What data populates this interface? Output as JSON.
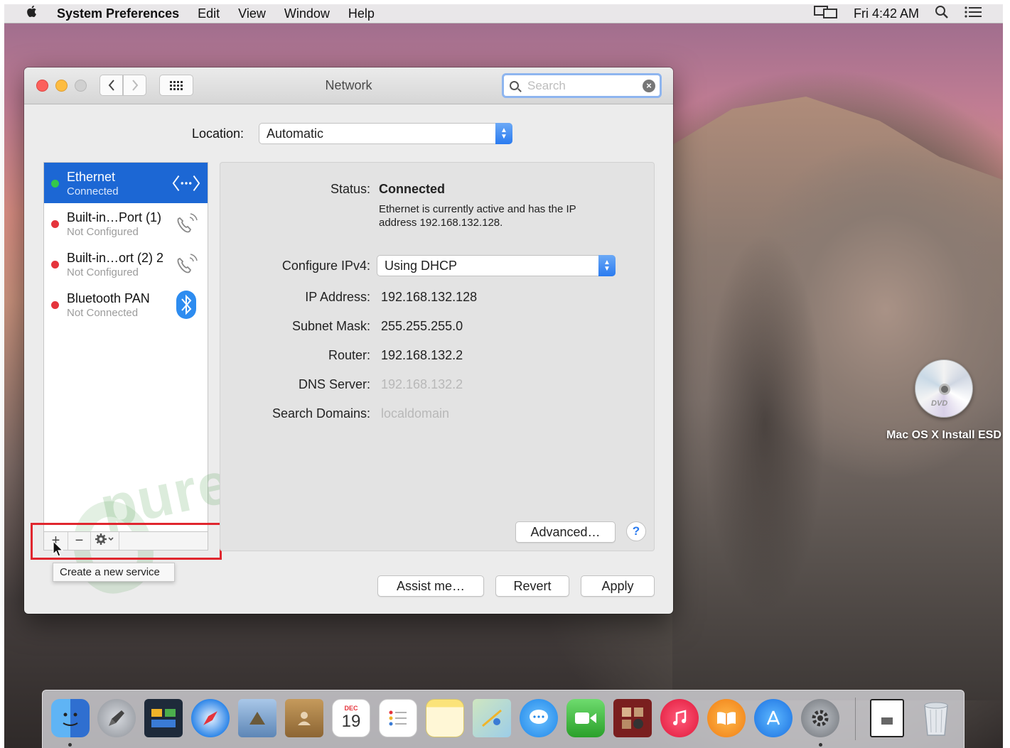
{
  "menubar": {
    "app_name": "System Preferences",
    "items": [
      "Edit",
      "View",
      "Window",
      "Help"
    ],
    "clock": "Fri 4:42 AM"
  },
  "window": {
    "title": "Network",
    "search_placeholder": "Search"
  },
  "location": {
    "label": "Location:",
    "value": "Automatic"
  },
  "services": [
    {
      "name": "Ethernet",
      "status": "Connected",
      "status_color": "#34c84a",
      "icon": "ethernet-arrows-icon",
      "selected": true
    },
    {
      "name": "Built-in…Port (1)",
      "status": "Not Configured",
      "status_color": "#e5343c",
      "icon": "phone-icon",
      "selected": false
    },
    {
      "name": "Built-in…ort (2) 2",
      "status": "Not Configured",
      "status_color": "#e5343c",
      "icon": "phone-icon",
      "selected": false
    },
    {
      "name": "Bluetooth PAN",
      "status": "Not Connected",
      "status_color": "#e5343c",
      "icon": "bluetooth-icon",
      "selected": false
    }
  ],
  "sidebar_toolbar": {
    "add": "+",
    "remove": "−",
    "tooltip": "Create a new service"
  },
  "details": {
    "status_label": "Status:",
    "status_value": "Connected",
    "status_description": "Ethernet is currently active and has the IP address 192.168.132.128.",
    "configure_label": "Configure IPv4:",
    "configure_value": "Using DHCP",
    "ip_label": "IP Address:",
    "ip_value": "192.168.132.128",
    "subnet_label": "Subnet Mask:",
    "subnet_value": "255.255.255.0",
    "router_label": "Router:",
    "router_value": "192.168.132.2",
    "dns_label": "DNS Server:",
    "dns_value": "192.168.132.2",
    "domains_label": "Search Domains:",
    "domains_value": "localdomain",
    "advanced_button": "Advanced…",
    "help_button": "?"
  },
  "footer": {
    "assist_button": "Assist me…",
    "revert_button": "Revert",
    "apply_button": "Apply"
  },
  "watermark": "purevpn",
  "desktop": {
    "dvd_label": "Mac OS X Install ESD",
    "dvd_text": "DVD"
  },
  "dock": {
    "calendar_month": "DEC",
    "calendar_day": "19",
    "apps": [
      "Finder",
      "Launchpad",
      "Mission Control",
      "Safari",
      "Preview",
      "Contacts",
      "Calendar",
      "Reminders",
      "Notes",
      "Maps",
      "Messages",
      "FaceTime",
      "Photo Booth",
      "iTunes",
      "iBooks",
      "App Store",
      "System Preferences",
      "Document",
      "Trash"
    ]
  },
  "colors": {
    "accent": "#1c67d4",
    "highlight": "#e0262e"
  }
}
